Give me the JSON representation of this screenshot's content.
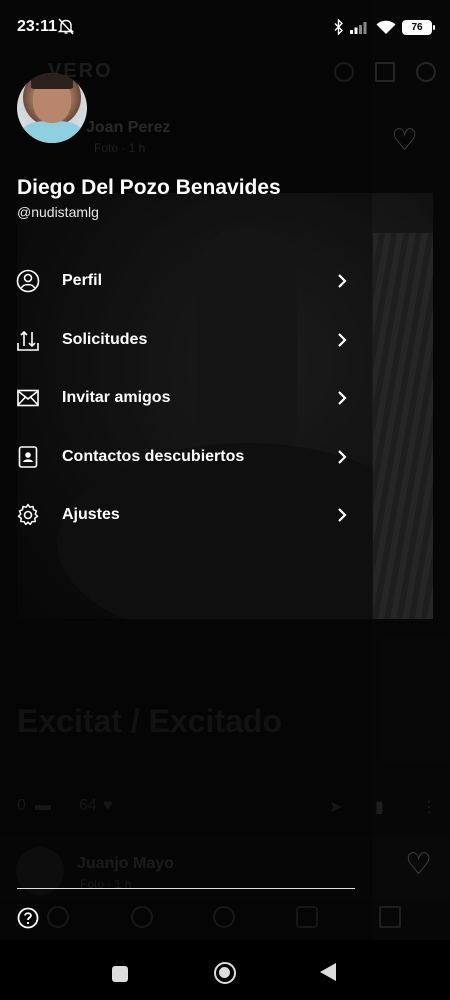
{
  "status_bar": {
    "time": "23:11",
    "battery": "76"
  },
  "feed": {
    "logo": "VERO",
    "post": {
      "author": "Joan Perez",
      "meta": "Foto · 1 h",
      "title": "Excitat / Excitado",
      "comments": "0",
      "likes": "64"
    },
    "next_post": {
      "author": "Juanjo Mayo",
      "meta": "Foto · 1 h"
    }
  },
  "drawer": {
    "user": {
      "name": "Diego Del Pozo Benavides",
      "handle": "@nudistamlg"
    },
    "menu": [
      {
        "label": "Perfil",
        "icon": "profile-icon"
      },
      {
        "label": "Solicitudes",
        "icon": "requests-icon"
      },
      {
        "label": "Invitar amigos",
        "icon": "envelope-icon"
      },
      {
        "label": "Contactos descubiertos",
        "icon": "contact-card-icon"
      },
      {
        "label": "Ajustes",
        "icon": "gear-icon"
      }
    ],
    "help_icon": "help-icon"
  },
  "colors": {
    "background": "#000000",
    "text": "#ffffff",
    "accent_blue": "#1ea0ff"
  }
}
